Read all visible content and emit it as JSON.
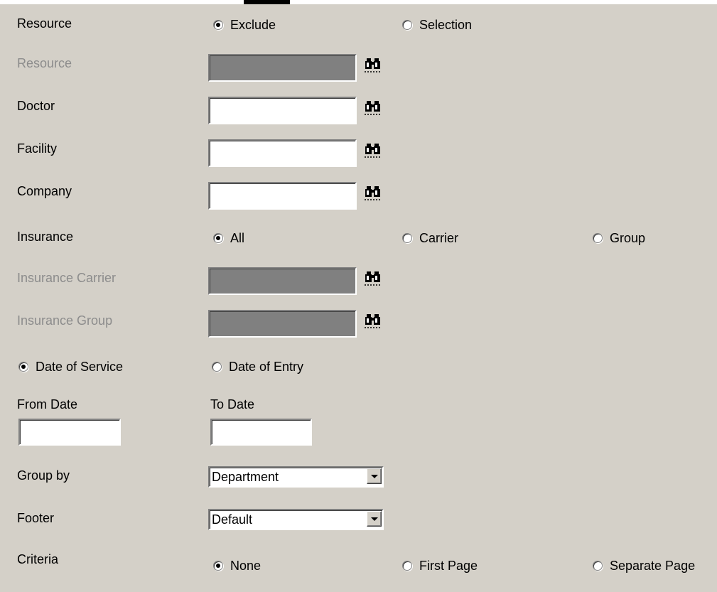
{
  "resource_mode": {
    "label": "Resource",
    "options": [
      "Exclude",
      "Selection"
    ],
    "selected": "Exclude"
  },
  "resource": {
    "label": "Resource",
    "enabled": false,
    "value": ""
  },
  "doctor": {
    "label": "Doctor",
    "value": ""
  },
  "facility": {
    "label": "Facility",
    "value": ""
  },
  "company": {
    "label": "Company",
    "value": ""
  },
  "insurance": {
    "label": "Insurance",
    "options": [
      "All",
      "Carrier",
      "Group"
    ],
    "selected": "All"
  },
  "insurance_carrier": {
    "label": "Insurance Carrier",
    "enabled": false,
    "value": ""
  },
  "insurance_group": {
    "label": "Insurance Group",
    "enabled": false,
    "value": ""
  },
  "date_type": {
    "options": [
      "Date of Service",
      "Date of Entry"
    ],
    "selected": "Date of Service"
  },
  "from_date": {
    "label": "From Date",
    "value": ""
  },
  "to_date": {
    "label": "To Date",
    "value": ""
  },
  "group_by": {
    "label": "Group by",
    "value": "Department"
  },
  "footer": {
    "label": "Footer",
    "value": "Default"
  },
  "criteria": {
    "label": "Criteria",
    "options": [
      "None",
      "First Page",
      "Separate Page"
    ],
    "selected": "None"
  },
  "icons": {
    "lookup": "binoculars-icon"
  },
  "colors": {
    "background": "#d4d0c8",
    "disabled_field": "#808080",
    "disabled_text": "#8c8c8c"
  }
}
